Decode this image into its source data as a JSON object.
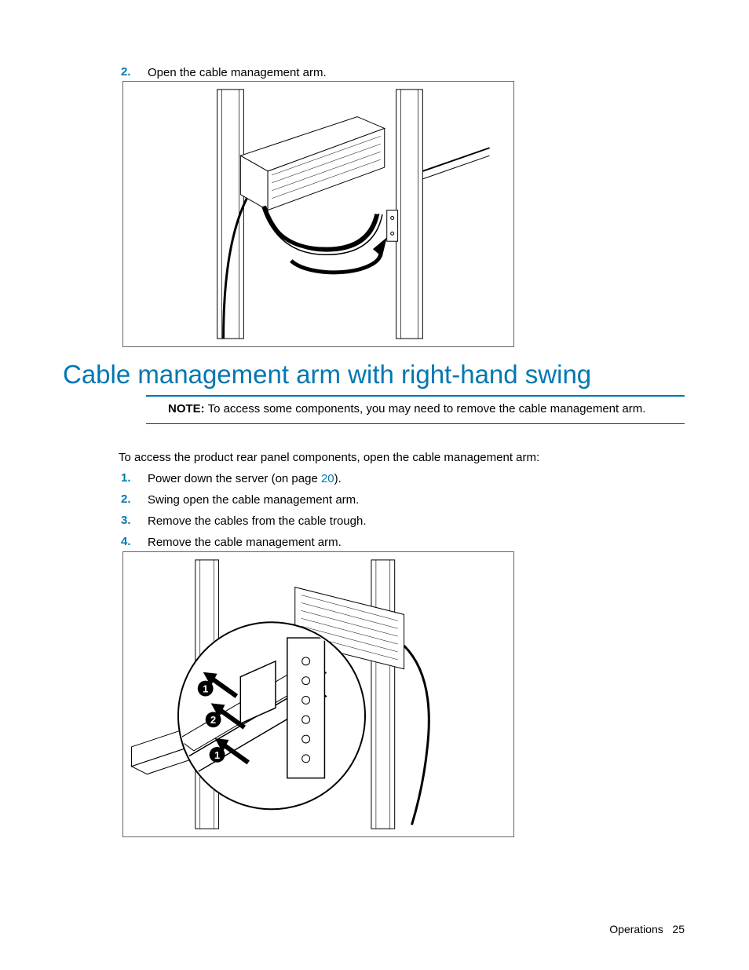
{
  "top_step": {
    "num": "2.",
    "text": "Open the cable management arm."
  },
  "heading": "Cable management arm with right-hand swing",
  "note": {
    "label": "NOTE:",
    "text": "To access some components, you may need to remove the cable management arm."
  },
  "intro": "To access the product rear panel components, open the cable management arm:",
  "steps": [
    {
      "num": "1.",
      "text_a": "Power down the server (on page ",
      "link": "20",
      "text_b": ")."
    },
    {
      "num": "2.",
      "text_a": "Swing open the cable management arm.",
      "link": "",
      "text_b": ""
    },
    {
      "num": "3.",
      "text_a": "Remove the cables from the cable trough.",
      "link": "",
      "text_b": ""
    },
    {
      "num": "4.",
      "text_a": "Remove the cable management arm.",
      "link": "",
      "text_b": ""
    }
  ],
  "footer": {
    "section": "Operations",
    "page": "25"
  }
}
